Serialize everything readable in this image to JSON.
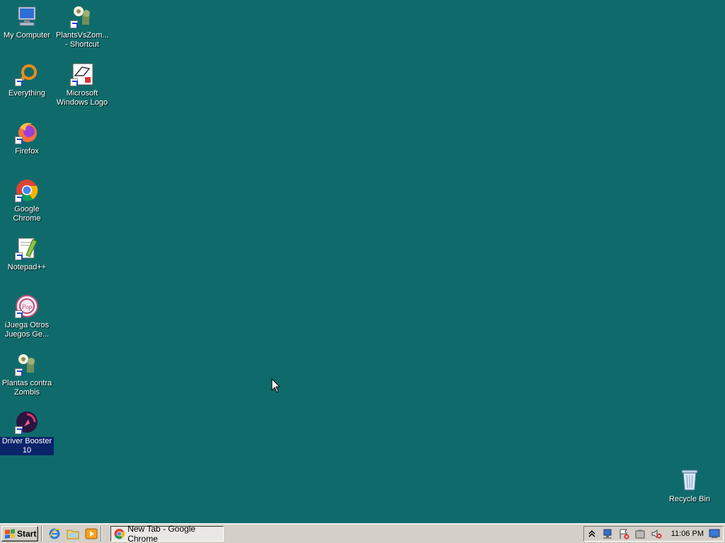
{
  "desktop": {
    "background": "#0f6b6b",
    "icons": [
      {
        "label": "My Computer",
        "icon": "computer-icon",
        "shortcut": false
      },
      {
        "label": "PlantsVsZom...\n- Shortcut",
        "icon": "plants-vs-zombies-icon",
        "shortcut": true
      },
      {
        "label": "Everything",
        "icon": "everything-search-icon",
        "shortcut": true
      },
      {
        "label": "Microsoft\nWindows Logo",
        "icon": "windows-logo-doc-icon",
        "shortcut": true
      },
      {
        "label": "Firefox",
        "icon": "firefox-icon",
        "shortcut": true
      },
      {
        "label": "Google Chrome",
        "icon": "chrome-icon",
        "shortcut": true
      },
      {
        "label": "Notepad++",
        "icon": "notepad-plus-plus-icon",
        "shortcut": true
      },
      {
        "label": "iJuega Otros\nJuegos Ge...",
        "icon": "popcap-games-icon",
        "shortcut": true
      },
      {
        "label": "Plantas contra\nZombis",
        "icon": "plantas-contra-zombis-icon",
        "shortcut": true
      },
      {
        "label": "Driver Booster\n10",
        "icon": "driver-booster-icon",
        "shortcut": true,
        "selected": true
      },
      {
        "label": "Recycle Bin",
        "icon": "recycle-bin-icon",
        "shortcut": false
      }
    ]
  },
  "taskbar": {
    "start_label": "Start",
    "quick_launch": [
      "internet-explorer-icon",
      "folder-icon",
      "media-player-icon"
    ],
    "tasks": [
      {
        "label": "New Tab - Google Chrome",
        "icon": "chrome-icon"
      }
    ],
    "tray_icons": [
      "show-hidden-icons-chevron",
      "network-icon",
      "action-center-flag-icon",
      "safely-remove-hardware-icon",
      "volume-muted-icon"
    ],
    "clock": "11:06 PM",
    "show_desktop": "show-desktop-icon"
  }
}
